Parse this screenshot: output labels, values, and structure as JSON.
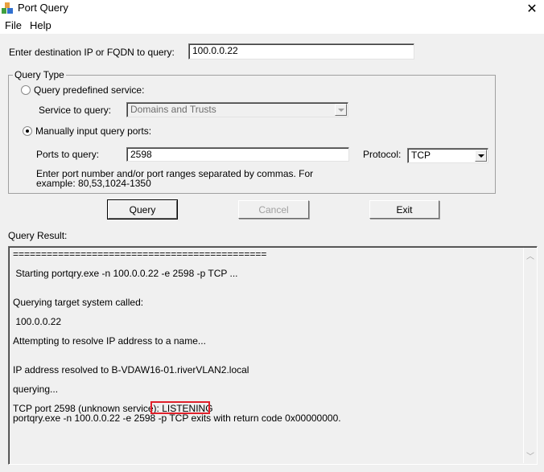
{
  "window": {
    "title": "Port Query",
    "icon": "app-blocks-icon",
    "close_icon": "close-icon"
  },
  "menu": {
    "items": [
      "File",
      "Help"
    ]
  },
  "destination": {
    "label": "Enter destination IP or FQDN to query:",
    "value": "100.0.0.22"
  },
  "query_type": {
    "title": "Query Type",
    "predefined": {
      "label": "Query predefined service:",
      "checked": false,
      "service_label": "Service to query:",
      "service_value": "Domains and Trusts"
    },
    "manual": {
      "label": "Manually input query ports:",
      "checked": true,
      "ports_label": "Ports to query:",
      "ports_value": "2598",
      "protocol_label": "Protocol:",
      "protocol_value": "TCP",
      "hint_line1": "Enter port number and/or port ranges separated by commas. For",
      "hint_line2": "example: 80,53,1024-1350"
    }
  },
  "buttons": {
    "query": "Query",
    "cancel": "Cancel",
    "exit": "Exit"
  },
  "result": {
    "label": "Query Result:",
    "lines": [
      "=============================================",
      " Starting portqry.exe -n 100.0.0.22 -e 2598 -p TCP ...",
      "Querying target system called:",
      " 100.0.0.22",
      "Attempting to resolve IP address to a name...",
      "IP address resolved to B-VDAW16-01.riverVLAN2.local",
      "querying...",
      "TCP port 2598 (unknown service): LISTENING",
      "portqry.exe -n 100.0.0.22 -e 2598 -p TCP exits with return code 0x00000000."
    ],
    "highlighted_text": "LISTENING",
    "highlight_color": "#e0202a"
  }
}
